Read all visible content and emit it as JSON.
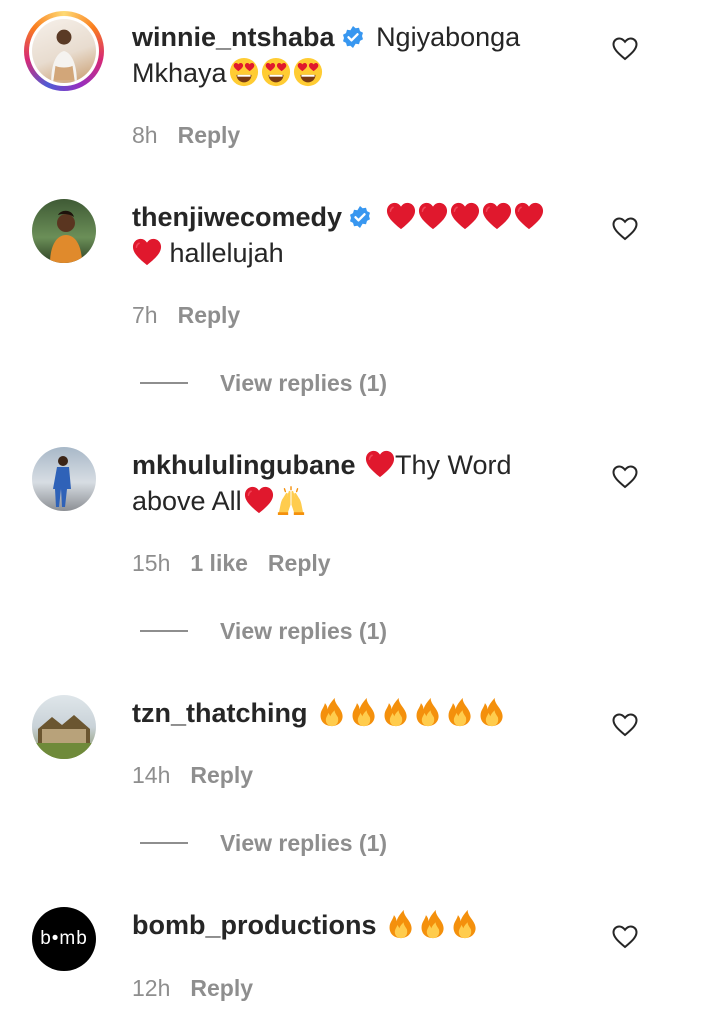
{
  "comments": [
    {
      "username": "winnie_ntshaba",
      "verified": true,
      "text": "Ngiyabonga Mkhaya",
      "emojis": [
        "heart-eyes",
        "heart-eyes",
        "heart-eyes"
      ],
      "time": "8h",
      "reply_label": "Reply"
    },
    {
      "username": "thenjiwecomedy",
      "verified": true,
      "text": "hallelujah",
      "emojis": [
        "red-heart",
        "red-heart",
        "red-heart",
        "red-heart",
        "red-heart",
        "red-heart"
      ],
      "time": "7h",
      "reply_label": "Reply",
      "view_replies": "View replies (1)"
    },
    {
      "username": "mkhululingubane",
      "verified": false,
      "text_a": "Thy Word",
      "text_b": "above All",
      "emojis": [
        "red-heart",
        "red-heart",
        "raising-hands"
      ],
      "time": "15h",
      "likes": "1 like",
      "reply_label": "Reply",
      "view_replies": "View replies (1)"
    },
    {
      "username": "tzn_thatching",
      "verified": false,
      "text": "",
      "emojis": [
        "fire",
        "fire",
        "fire",
        "fire",
        "fire",
        "fire"
      ],
      "time": "14h",
      "reply_label": "Reply",
      "view_replies": "View replies (1)"
    },
    {
      "username": "bomb_productions",
      "verified": false,
      "text": "",
      "emojis": [
        "fire",
        "fire",
        "fire"
      ],
      "time": "12h",
      "reply_label": "Reply",
      "avatar_text": "b•mb"
    }
  ],
  "colors": {
    "text": "#262626",
    "meta": "#8e8e8e",
    "verified": "#3897f0",
    "heart": "#e0182d"
  }
}
